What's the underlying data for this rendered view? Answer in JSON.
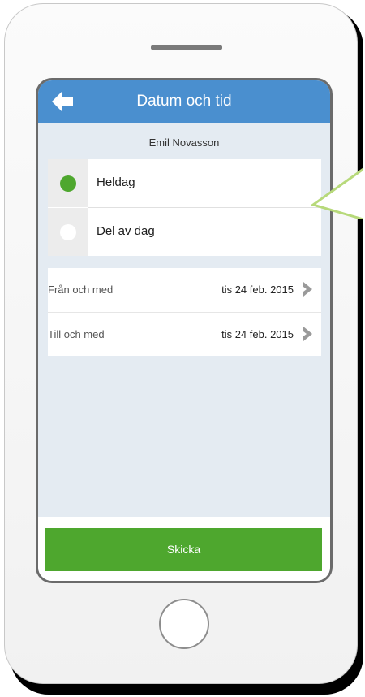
{
  "header": {
    "title": "Datum och tid",
    "back_icon": "back-arrow-icon"
  },
  "user": {
    "name": "Emil Novasson"
  },
  "options": [
    {
      "label": "Heldag",
      "selected": true
    },
    {
      "label": "Del av dag",
      "selected": false
    }
  ],
  "dates": [
    {
      "label": "Från och med",
      "value": "tis 24 feb. 2015"
    },
    {
      "label": "Till och med",
      "value": "tis 24 feb. 2015"
    }
  ],
  "actions": {
    "submit_label": "Skicka"
  },
  "colors": {
    "header_blue": "#4a8fcf",
    "accent_green": "#4ea72e",
    "screen_bg": "#e4ebf2",
    "callout_green": "#b7d97a"
  }
}
